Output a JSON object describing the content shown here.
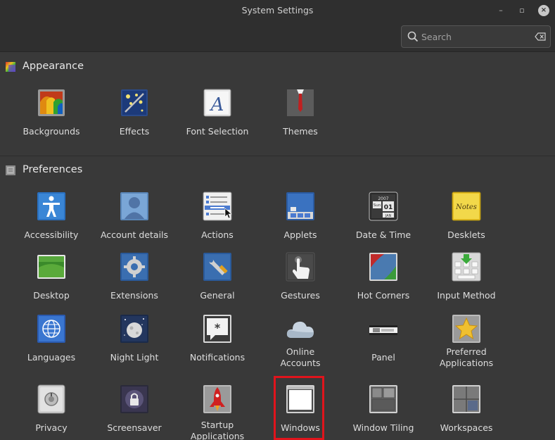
{
  "window": {
    "title": "System Settings",
    "minimize_glyph": "–",
    "maximize_glyph": "▫",
    "close_glyph": "×"
  },
  "search": {
    "placeholder": "Search",
    "value": ""
  },
  "sections": [
    {
      "title": "Appearance",
      "items": [
        {
          "label": "Backgrounds",
          "icon": "backgrounds-icon"
        },
        {
          "label": "Effects",
          "icon": "effects-icon"
        },
        {
          "label": "Font Selection",
          "icon": "font-selection-icon"
        },
        {
          "label": "Themes",
          "icon": "themes-icon"
        }
      ]
    },
    {
      "title": "Preferences",
      "items": [
        {
          "label": "Accessibility",
          "icon": "accessibility-icon"
        },
        {
          "label": "Account details",
          "icon": "account-details-icon"
        },
        {
          "label": "Actions",
          "icon": "actions-icon"
        },
        {
          "label": "Applets",
          "icon": "applets-icon"
        },
        {
          "label": "Date & Time",
          "icon": "date-time-icon",
          "icon_text": {
            "year": "2007",
            "day": "Sun",
            "date": "01",
            "month": "JAN"
          }
        },
        {
          "label": "Desklets",
          "icon": "desklets-icon",
          "icon_text": "Notes"
        },
        {
          "label": "Desktop",
          "icon": "desktop-icon"
        },
        {
          "label": "Extensions",
          "icon": "extensions-icon"
        },
        {
          "label": "General",
          "icon": "general-icon"
        },
        {
          "label": "Gestures",
          "icon": "gestures-icon"
        },
        {
          "label": "Hot Corners",
          "icon": "hot-corners-icon"
        },
        {
          "label": "Input Method",
          "icon": "input-method-icon"
        },
        {
          "label": "Languages",
          "icon": "languages-icon"
        },
        {
          "label": "Night Light",
          "icon": "night-light-icon"
        },
        {
          "label": "Notifications",
          "icon": "notifications-icon"
        },
        {
          "label": "Online Accounts",
          "label_lines": [
            "Online",
            "Accounts"
          ],
          "icon": "online-accounts-icon"
        },
        {
          "label": "Panel",
          "icon": "panel-icon"
        },
        {
          "label": "Preferred Applications",
          "label_lines": [
            "Preferred",
            "Applications"
          ],
          "icon": "preferred-applications-icon"
        },
        {
          "label": "Privacy",
          "icon": "privacy-icon"
        },
        {
          "label": "Screensaver",
          "icon": "screensaver-icon"
        },
        {
          "label": "Startup Applications",
          "label_lines": [
            "Startup",
            "Applications"
          ],
          "icon": "startup-applications-icon"
        },
        {
          "label": "Windows",
          "icon": "windows-icon",
          "highlighted": true
        },
        {
          "label": "Window Tiling",
          "icon": "window-tiling-icon"
        },
        {
          "label": "Workspaces",
          "icon": "workspaces-icon"
        }
      ]
    }
  ],
  "colors": {
    "background": "#393939",
    "header": "#2f2f2f",
    "highlight": "#e0141c"
  }
}
